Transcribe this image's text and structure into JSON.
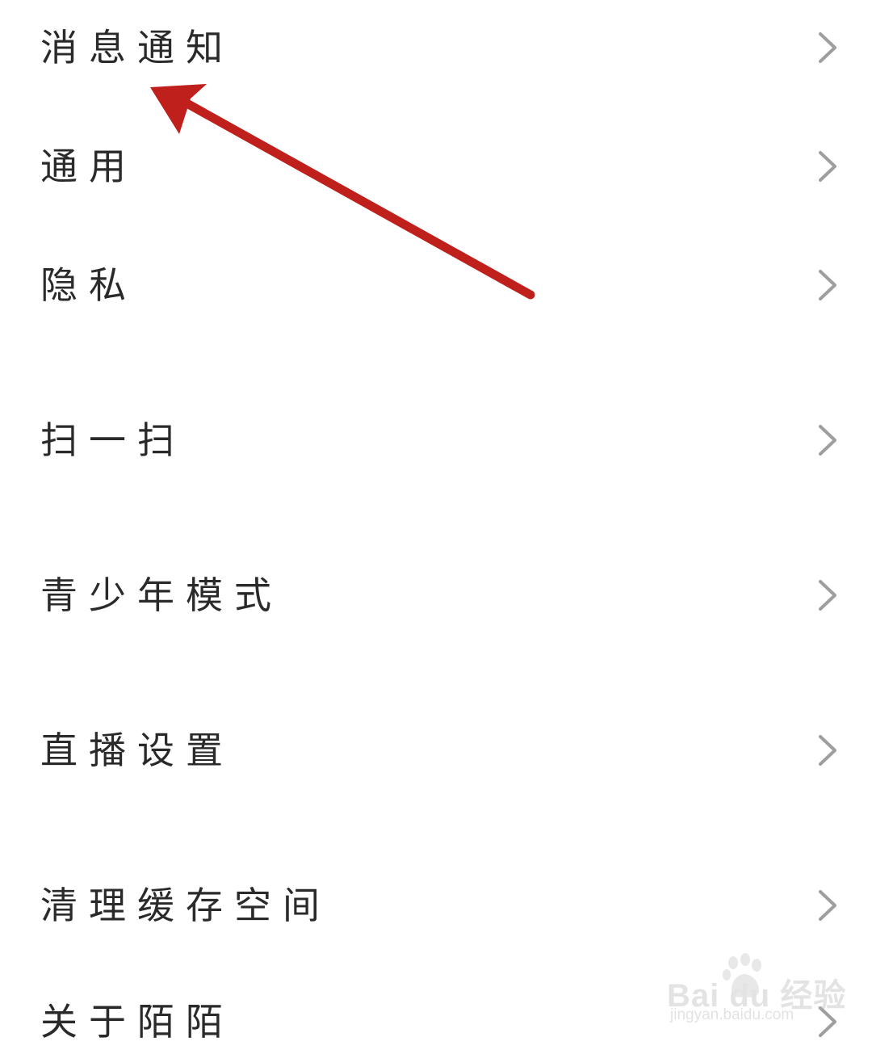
{
  "settings": {
    "items": [
      {
        "label": "消息通知",
        "icon": "chevron-right-icon"
      },
      {
        "label": "通用",
        "icon": "chevron-right-icon"
      },
      {
        "label": "隐私",
        "icon": "chevron-right-icon"
      },
      {
        "label": "扫一扫",
        "icon": "chevron-right-icon"
      },
      {
        "label": "青少年模式",
        "icon": "chevron-right-icon"
      },
      {
        "label": "直播设置",
        "icon": "chevron-right-icon"
      },
      {
        "label": "清理缓存空间",
        "icon": "chevron-right-icon"
      },
      {
        "label": "关于陌陌",
        "icon": "chevron-right-icon"
      }
    ]
  },
  "annotation": {
    "icon": "red-arrow-annotation",
    "color": "#c0201c"
  },
  "watermark": {
    "logo_text": "Bai du 经验",
    "url": "jingyan.baidu.com",
    "icon": "baidu-paw-icon"
  },
  "colors": {
    "background": "#ffffff",
    "text": "#2a2a2a",
    "chevron": "#9e9e9e"
  }
}
